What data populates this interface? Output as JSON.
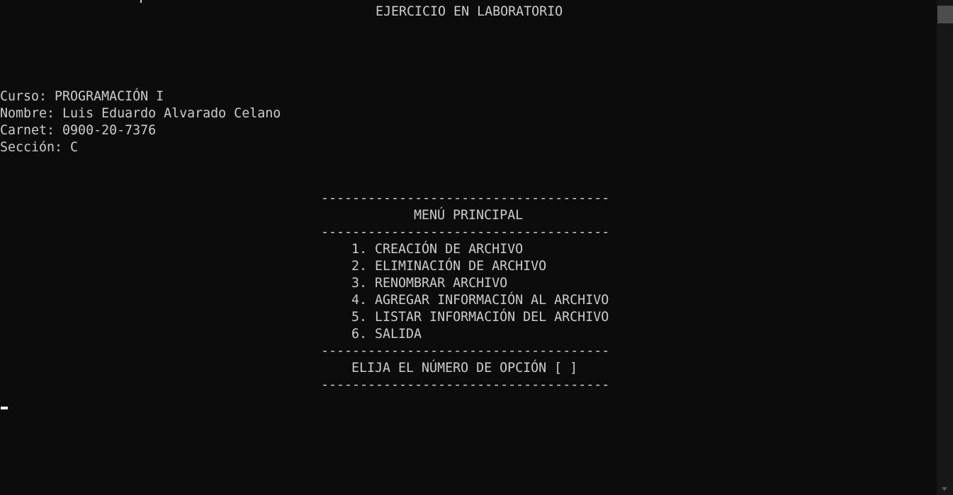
{
  "console": {
    "title": "EJERCICIO EN LABORATORIO",
    "info": {
      "curso": "Curso: PROGRAMACIÓN I",
      "nombre": "Nombre: Luis Eduardo Alvarado Celano",
      "carnet": "Carnet: 0900-20-7376",
      "seccion": "Sección: C"
    },
    "menu": {
      "separator": "-------------------------------------",
      "heading": "MENÚ PRINCIPAL",
      "options": [
        "1. CREACIÓN DE ARCHIVO",
        "2. ELIMINACIÓN DE ARCHIVO",
        "3. RENOMBRAR ARCHIVO",
        "4. AGREGAR INFORMACIÓN AL ARCHIVO",
        "5. LISTAR INFORMACIÓN DEL ARCHIVO",
        "6. SALIDA"
      ],
      "prompt": "ELIJA EL NÚMERO DE OPCIÓN [ ]"
    }
  }
}
